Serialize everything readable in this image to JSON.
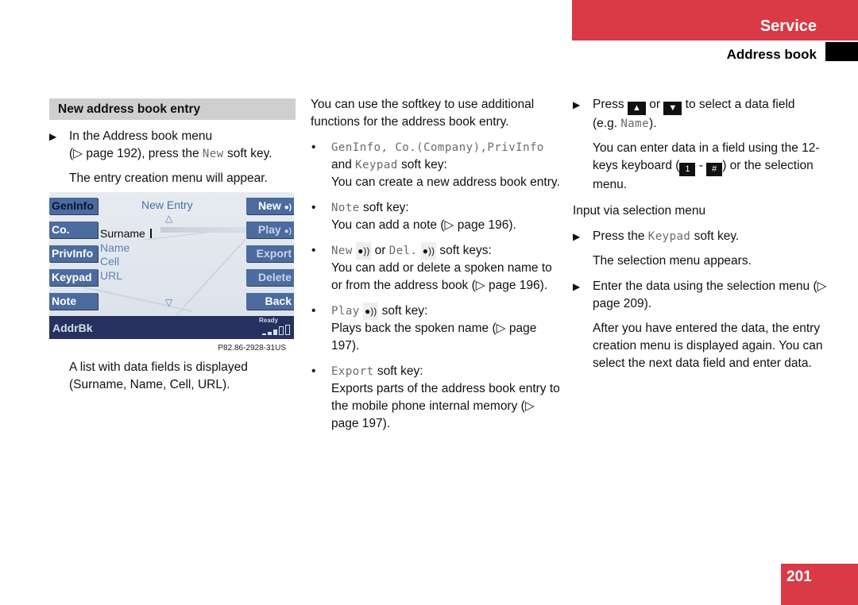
{
  "header": {
    "section": "Service",
    "subsection": "Address book",
    "accent_color": "#d93a45"
  },
  "col1": {
    "heading": "New address book entry",
    "step1_line1": "In the Address book menu",
    "step1_pre": "(▷ page 192), press the ",
    "step1_key": "New",
    "step1_post": " soft key.",
    "result1": "The entry creation menu will appear.",
    "screen": {
      "title": "New Entry",
      "left_keys": [
        "GenInfo",
        "Co.",
        "PrivInfo",
        "Keypad",
        "Note"
      ],
      "right_keys": [
        "New",
        "Play",
        "Export",
        "Delete",
        "Back"
      ],
      "fields": [
        "Surname",
        "Name",
        "Cell",
        "URL"
      ],
      "status_label": "AddrBk",
      "status_text": "Ready",
      "signal_level": 3,
      "signal_max": 5
    },
    "figure_id": "P82.86-2928-31US",
    "caption": "A list with data fields is displayed (Surname, Name, Cell, URL)."
  },
  "col2": {
    "intro": "You can use the softkey to use additional functions for the address book entry.",
    "b1_keys": "GenInfo, Co.(Company),PrivInfo",
    "b1_and": "and ",
    "b1_key2": "Keypad",
    "b1_tail": " soft key:",
    "b1_desc": "You can create a new address book entry.",
    "b2_key": "Note",
    "b2_tail": " soft key:",
    "b2_desc": "You can add a note (▷ page 196).",
    "b3_key1": "New",
    "b3_or": " or ",
    "b3_key2": "Del.",
    "b3_tail": " soft keys:",
    "b3_desc": "You can add or delete a spoken name to or from the address book (▷ page 196).",
    "b4_key": "Play",
    "b4_tail": " soft key:",
    "b4_desc": "Plays back the spoken name (▷ page 197).",
    "b5_key": "Export",
    "b5_tail": " soft key:",
    "b5_desc": "Exports parts of the address book entry to the mobile phone internal memory (▷ page 197)."
  },
  "col3": {
    "s1_press": "Press ",
    "s1_or": " or ",
    "s1_tail": " to select a data field",
    "s1_eg_pre": "(e.g. ",
    "s1_eg_key": "Name",
    "s1_eg_post": ").",
    "p1_a": "You can enter data in a field using the 12-keys keyboard (",
    "p1_dash": " - ",
    "p1_b": ") or the selection menu.",
    "key_up": "▲",
    "key_down": "▼",
    "key_1": "1",
    "key_hash": "#",
    "subhead": "Input via selection menu",
    "s2_pre": "Press the ",
    "s2_key": "Keypad",
    "s2_post": " soft key.",
    "r2": "The selection menu appears.",
    "s3": "Enter the data using the selection menu (▷ page 209).",
    "r3": "After you have entered the data, the entry creation menu is displayed again. You can select the next data field and enter data."
  },
  "page_number": "201"
}
